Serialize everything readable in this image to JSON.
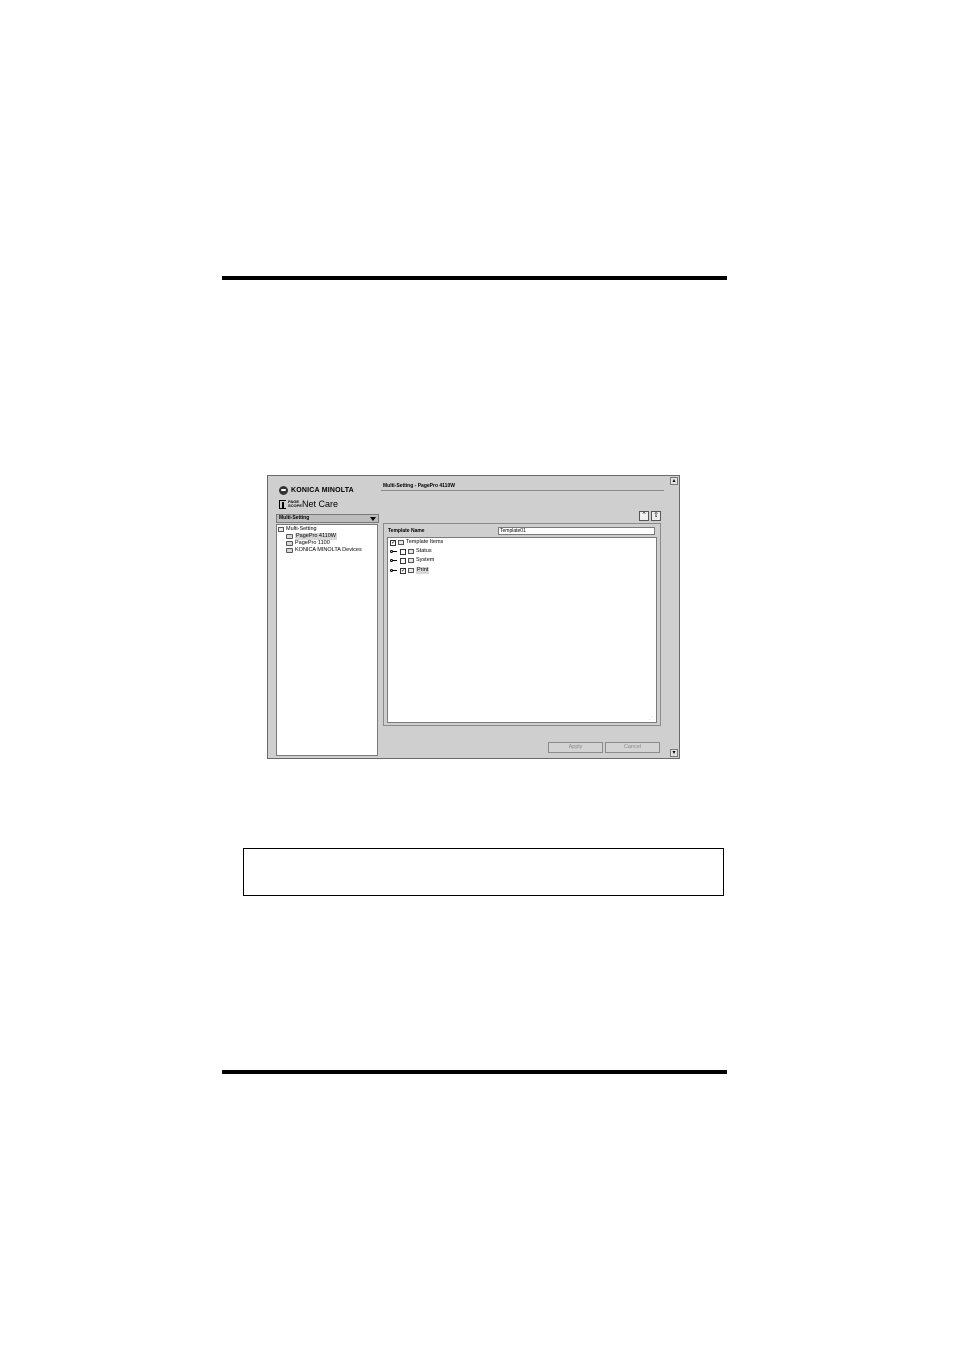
{
  "app": {
    "brand": "KONICA MINOLTA",
    "product_small": "PAGE SCOPE",
    "product_name": "Net Care"
  },
  "left_panel": {
    "section_title": "Multi-Setting",
    "tree": [
      {
        "label": "Multi-Setting",
        "icon": "folder-icon"
      },
      {
        "label": "PagePro 4110W",
        "icon": "printer-icon",
        "selected": true
      },
      {
        "label": "PagePro 1100",
        "icon": "printer-icon"
      },
      {
        "label": "KONICA MINOLTA Devices",
        "icon": "printer-icon"
      }
    ]
  },
  "right_panel": {
    "header": "Multi-Setting - PagePro 4110W",
    "toolbar": {
      "up_all_icon": "double-up-icon",
      "up_icon": "up-arrow-icon"
    },
    "template_name_label": "Template Name",
    "template_name_value": "Template01",
    "items": [
      {
        "label": "Template Items",
        "checked": true
      },
      {
        "label": "Status",
        "checked": false
      },
      {
        "label": "System",
        "checked": false
      },
      {
        "label": "Print",
        "checked": true
      }
    ],
    "apply_label": "Apply",
    "cancel_label": "Cancel"
  }
}
